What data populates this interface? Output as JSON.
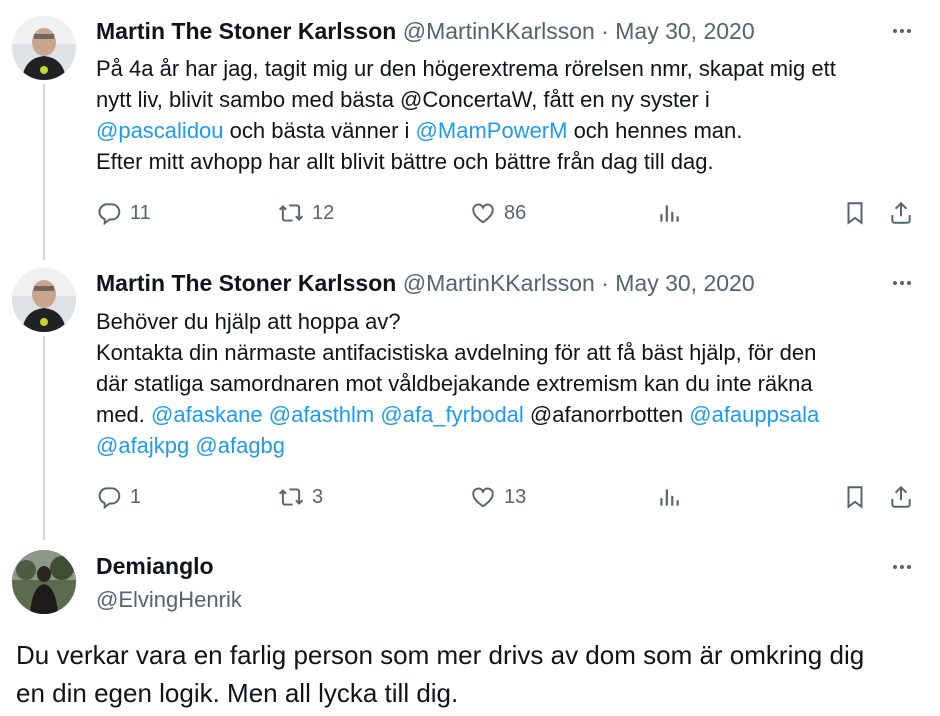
{
  "tweets": [
    {
      "name": "Martin The Stoner Karlsson",
      "handle": "@MartinKKarlsson",
      "separator": "·",
      "date": "May 30, 2020",
      "text_lines": [
        [
          {
            "t": "På 4a år har jag, tagit mig ur den högerextrema rörelsen nmr, skapat mig ett",
            "m": false
          }
        ],
        [
          {
            "t": "nytt liv, blivit sambo med bästa @ConcertaW, fått en ny syster i",
            "m": false
          }
        ],
        [
          {
            "t": "@pascalidou",
            "m": true
          },
          {
            "t": " och bästa vänner i ",
            "m": false
          },
          {
            "t": "@MamPowerM",
            "m": true
          },
          {
            "t": " och hennes man.",
            "m": false
          }
        ],
        [
          {
            "t": "Efter mitt avhopp har allt blivit bättre och bättre från dag till dag.",
            "m": false
          }
        ]
      ],
      "replies": "11",
      "retweets": "12",
      "likes": "86"
    },
    {
      "name": "Martin The Stoner Karlsson",
      "handle": "@MartinKKarlsson",
      "separator": "·",
      "date": "May 30, 2020",
      "text_lines": [
        [
          {
            "t": "Behöver du hjälp att hoppa av?",
            "m": false
          }
        ],
        [
          {
            "t": "Kontakta din närmaste antifacistiska avdelning för att få bäst hjälp, för den",
            "m": false
          }
        ],
        [
          {
            "t": "där statliga samordnaren mot våldbejakande extremism kan du inte räkna",
            "m": false
          }
        ],
        [
          {
            "t": "med. ",
            "m": false
          },
          {
            "t": "@afaskane",
            "m": true
          },
          {
            "t": " ",
            "m": false
          },
          {
            "t": "@afasthlm",
            "m": true
          },
          {
            "t": " ",
            "m": false
          },
          {
            "t": "@afa_fyrbodal",
            "m": true
          },
          {
            "t": " @afanorrbotten ",
            "m": false
          },
          {
            "t": "@afauppsala",
            "m": true
          }
        ],
        [
          {
            "t": "@afajkpg",
            "m": true
          },
          {
            "t": " ",
            "m": false
          },
          {
            "t": "@afagbg",
            "m": true
          }
        ]
      ],
      "replies": "1",
      "retweets": "3",
      "likes": "13"
    }
  ],
  "reply": {
    "name": "Demianglo",
    "handle": "@ElvingHenrik",
    "text_line1": "Du verkar vara en farlig person som mer drivs av dom som är omkring dig",
    "text_line2": "en din egen logik. Men all lycka till dig."
  },
  "icons": {
    "reply": "reply-icon",
    "retweet": "retweet-icon",
    "like": "heart-icon",
    "views": "views-icon",
    "bookmark": "bookmark-icon",
    "share": "share-icon",
    "more": "more-icon"
  },
  "colors": {
    "mention": "#1d9bf0",
    "secondary": "#536471",
    "text": "#0f1419",
    "thread_line": "#cfd9de"
  }
}
